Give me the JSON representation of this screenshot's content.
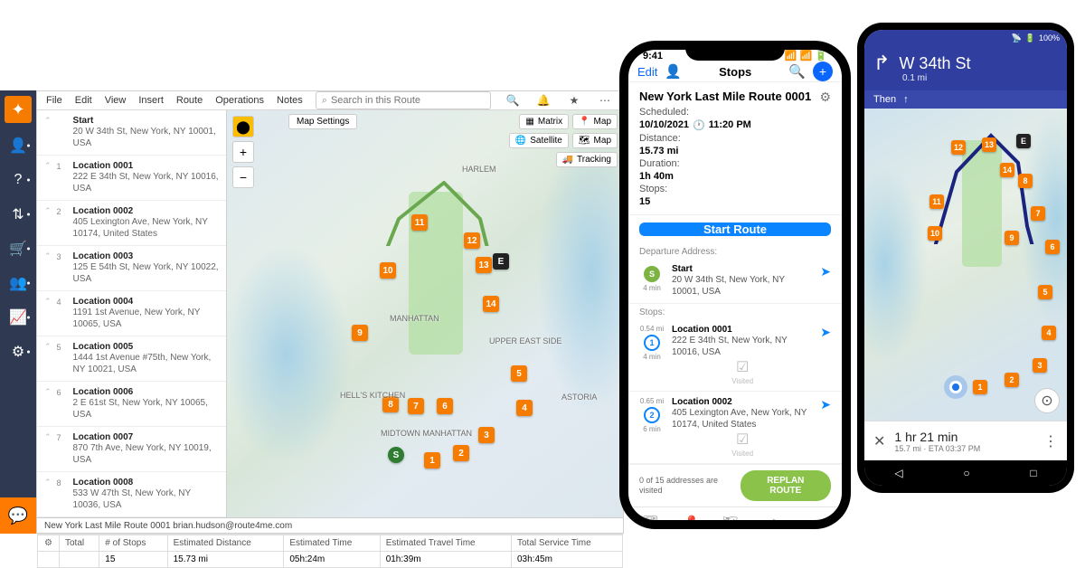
{
  "desktop": {
    "menu": [
      "File",
      "Edit",
      "View",
      "Insert",
      "Route",
      "Operations",
      "Notes"
    ],
    "search_placeholder": "Search in this Route",
    "map_settings_label": "Map Settings",
    "map_matrix_label": "Matrix",
    "map_map_label": "Map",
    "map_satellite_label": "Satellite",
    "map_map2_label": "Map",
    "map_tracking_label": "Tracking",
    "map_places": {
      "harlem": "HARLEM",
      "manhattan": "MANHATTAN",
      "hellskitchen": "HELL'S KITCHEN",
      "uppereast": "UPPER EAST SIDE",
      "midtown": "MIDTOWN MANHATTAN",
      "astoria": "ASTORIA"
    },
    "stops": [
      {
        "n": "",
        "name": "Start",
        "addr": "20 W 34th St, New York, NY 10001, USA"
      },
      {
        "n": "1",
        "name": "Location 0001",
        "addr": "222 E 34th St, New York, NY 10016, USA"
      },
      {
        "n": "2",
        "name": "Location 0002",
        "addr": "405 Lexington Ave, New York, NY 10174, United States"
      },
      {
        "n": "3",
        "name": "Location 0003",
        "addr": "125 E 54th St, New York, NY 10022, USA"
      },
      {
        "n": "4",
        "name": "Location 0004",
        "addr": "1191 1st Avenue, New York, NY 10065, USA"
      },
      {
        "n": "5",
        "name": "Location 0005",
        "addr": "1444 1st Avenue #75th, New York, NY 10021, USA"
      },
      {
        "n": "6",
        "name": "Location 0006",
        "addr": "2 E 61st St, New York, NY 10065, USA"
      },
      {
        "n": "7",
        "name": "Location 0007",
        "addr": "870 7th Ave, New York, NY 10019, USA"
      },
      {
        "n": "8",
        "name": "Location 0008",
        "addr": "533 W 47th St, New York, NY 10036, USA"
      }
    ],
    "summary": {
      "route_title": "New York Last Mile Route 0001  brian.hudson@route4me.com",
      "row_label": "Total",
      "headers": [
        "# of Stops",
        "Estimated Distance",
        "Estimated Time",
        "Estimated Travel Time",
        "Total Service Time"
      ],
      "values": [
        "15",
        "15.73 mi",
        "05h:24m",
        "01h:39m",
        "03h:45m"
      ]
    }
  },
  "iphone": {
    "time": "9:41",
    "edit_label": "Edit",
    "title": "Stops",
    "route_name": "New York Last Mile Route 0001",
    "scheduled_lbl": "Scheduled:",
    "scheduled_date": "10/10/2021",
    "scheduled_time": "11:20 PM",
    "distance_lbl": "Distance:",
    "distance_val": "15.73 mi",
    "duration_lbl": "Duration:",
    "duration_val": "1h 40m",
    "stops_lbl": "Stops:",
    "stops_val": "15",
    "start_route": "Start Route",
    "departure_lbl": "Departure Address:",
    "stops_section": "Stops:",
    "visited_lbl": "Visited",
    "progress_txt": "0 of 15 addresses are visited",
    "replan_label": "REPLAN ROUTE",
    "tabs": [
      "Routes",
      "Stops",
      "Map",
      "Navigation",
      "More"
    ],
    "stop_cards": [
      {
        "badge": "S",
        "time": "",
        "dist": "4 min",
        "name": "Start",
        "addr": "20 W 34th St, New York, NY 10001, USA"
      },
      {
        "badge": "1",
        "time": "0.54 mi",
        "dist": "4 min",
        "name": "Location 0001",
        "addr": "222 E 34th St, New York, NY 10016, USA"
      },
      {
        "badge": "2",
        "time": "0.65 mi",
        "dist": "6 min",
        "name": "Location 0002",
        "addr": "405 Lexington Ave, New York, NY 10174, United States"
      }
    ]
  },
  "android": {
    "battery": "100%",
    "street": "W 34th St",
    "dist": "0.1 mi",
    "then_label": "Then",
    "eta_big": "1 hr 21 min",
    "eta_sm": "15.7 mi · ETA 03:37 PM",
    "markers": [
      "1",
      "2",
      "3",
      "4",
      "5",
      "6",
      "7",
      "8",
      "9",
      "10",
      "11",
      "12",
      "13",
      "14",
      "E"
    ]
  }
}
